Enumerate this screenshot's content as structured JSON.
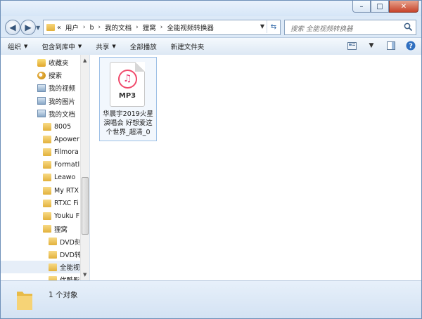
{
  "window": {
    "buttons": {
      "minimize": "–",
      "maximize": "□",
      "close": "✕"
    }
  },
  "address": {
    "overflow": "«",
    "crumbs": [
      "用户",
      "b",
      "我的文档",
      "狸窝",
      "全能视频转换器"
    ],
    "separator": "›"
  },
  "search": {
    "placeholder": "搜索 全能视频转换器"
  },
  "toolbar": {
    "organize": "组织",
    "include_in_library": "包含到库中",
    "share": "共享",
    "play_all": "全部播放",
    "new_folder": "新建文件夹"
  },
  "nav": {
    "items": [
      {
        "label": "收藏夹",
        "icon": "star-folder-icon"
      },
      {
        "label": "搜索",
        "icon": "search-folder-icon"
      },
      {
        "label": "我的视频",
        "icon": "library-icon"
      },
      {
        "label": "我的图片",
        "icon": "library-icon"
      },
      {
        "label": "我的文档",
        "icon": "library-icon"
      },
      {
        "label": "8005",
        "icon": "folder-icon"
      },
      {
        "label": "Apower",
        "icon": "folder-icon"
      },
      {
        "label": "Filmora",
        "icon": "folder-icon"
      },
      {
        "label": "Formatl",
        "icon": "folder-icon"
      },
      {
        "label": "Leawo",
        "icon": "folder-icon"
      },
      {
        "label": "My RTX",
        "icon": "folder-icon"
      },
      {
        "label": "RTXC Fi",
        "icon": "folder-icon"
      },
      {
        "label": "Youku F",
        "icon": "folder-icon"
      },
      {
        "label": "狸窝",
        "icon": "folder-icon"
      },
      {
        "label": "DVD刻",
        "icon": "folder-icon"
      },
      {
        "label": "DVD转",
        "icon": "folder-icon"
      },
      {
        "label": "全能视",
        "icon": "folder-icon",
        "selected": true
      },
      {
        "label": "优酷影",
        "icon": "folder-icon"
      }
    ]
  },
  "file": {
    "type_label": "MP3",
    "name_lines": [
      "华晨宇2019火星",
      "演唱会 好想爱这",
      "个世界_超清_0"
    ]
  },
  "status": {
    "count_text": "1 个对象"
  }
}
